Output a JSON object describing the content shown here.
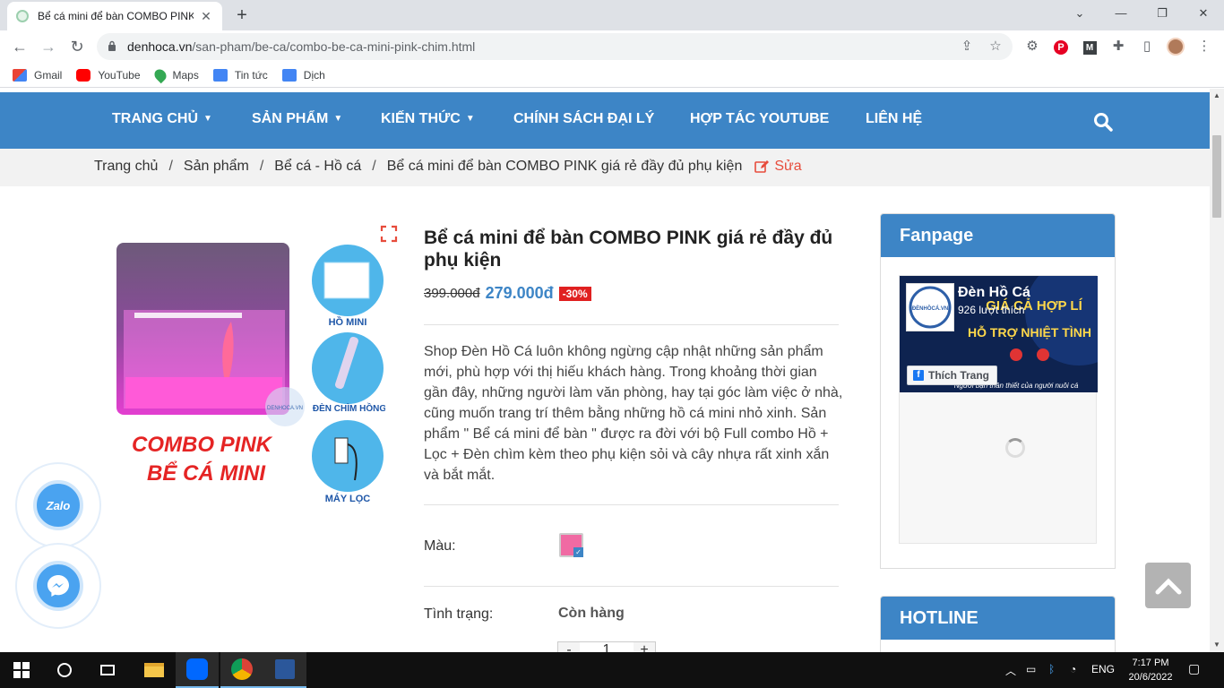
{
  "browser": {
    "tab_title": "Bể cá mini để bàn COMBO PINK giá",
    "url_host": "denhoca.vn",
    "url_path": "/san-pham/be-ca/combo-be-ca-mini-pink-chim.html",
    "bookmarks": [
      {
        "label": "Gmail",
        "color": "#ea4335"
      },
      {
        "label": "YouTube",
        "color": "#ff0000"
      },
      {
        "label": "Maps",
        "color": "#34a853"
      },
      {
        "label": "Tin tức",
        "color": "#4285f4"
      },
      {
        "label": "Dịch",
        "color": "#4285f4"
      }
    ]
  },
  "site": {
    "nav": [
      "TRANG CHỦ",
      "SẢN PHẨM",
      "KIẾN THỨC",
      "CHÍNH SÁCH ĐẠI LÝ",
      "HỢP TÁC YOUTUBE",
      "LIÊN HỆ"
    ],
    "breadcrumb": [
      "Trang chủ",
      "Sản phẩm",
      "Bể cá - Hồ cá",
      "Bể cá mini để bàn COMBO PINK giá rẻ đầy đủ phụ kiện"
    ],
    "edit_label": "Sửa",
    "accent": "#3d85c6"
  },
  "product": {
    "image": {
      "headline1": "COMBO PINK",
      "headline2": "BỂ CÁ MINI",
      "item1": "HỒ MINI",
      "item2": "ĐÈN CHÌM HỒNG",
      "item3": "MÁY LỌC",
      "watermark": "DENHOCA.VN"
    },
    "title": "Bể cá mini để bàn COMBO PINK giá rẻ đầy đủ phụ kiện",
    "old_price": "399.000đ",
    "price": "279.000đ",
    "discount": "-30%",
    "description": "Shop Đèn Hồ Cá luôn không ngừng cập nhật những sản phẩm mới, phù hợp với thị hiếu khách hàng. Trong khoảng thời gian gần đây, những người làm văn phòng, hay tại góc làm việc ở nhà, cũng muốn trang trí thêm bằng những hồ cá mini nhỏ xinh. Sản phẩm \" Bể cá mini để bàn \" được ra đời với bộ Full combo Hồ + Lọc + Đèn chìm kèm theo phụ kiện sỏi và cây nhựa rất xinh xắn và bắt mắt.",
    "color_label": "Màu:",
    "color_value": "#f06aa3",
    "status_label": "Tình trạng:",
    "status_value": "Còn hàng",
    "quantity": "1"
  },
  "sidebar": {
    "fanpage_title": "Fanpage",
    "fb_page_name": "Đèn Hồ Cá",
    "fb_likes": "926 lượt thích",
    "fb_like_button": "Thích Trang",
    "fb_logo_text": "ĐÈNHỒCÁ.VN",
    "fb_cover_line1": "GIÁ CẢ HỢP LÍ",
    "fb_cover_line2": "HỖ TRỢ NHIỆT TÌNH",
    "fb_cover_tagline": "Người bạn thân thiết của người nuôi cá",
    "hotline_title": "HOTLINE"
  },
  "floating": {
    "zalo": "Zalo"
  },
  "taskbar": {
    "lang": "ENG",
    "time": "7:17 PM",
    "date": "20/6/2022"
  }
}
